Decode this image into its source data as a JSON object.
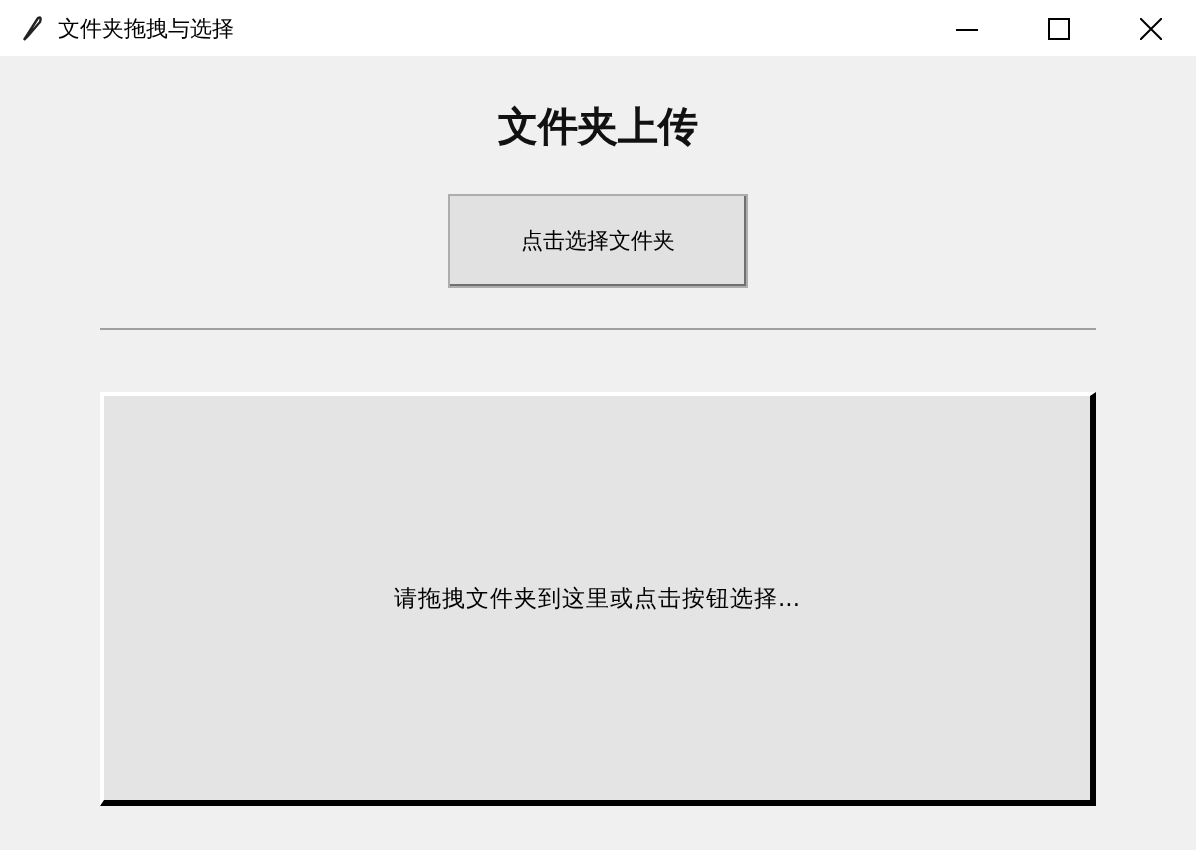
{
  "window": {
    "title": "文件夹拖拽与选择"
  },
  "heading": "文件夹上传",
  "select_button": "点击选择文件夹",
  "drop_area": {
    "hint": "请拖拽文件夹到这里或点击按钮选择..."
  }
}
